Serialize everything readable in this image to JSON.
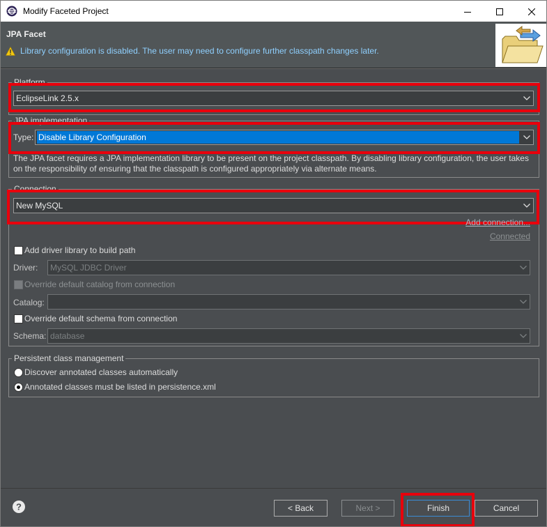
{
  "window": {
    "title": "Modify Faceted Project"
  },
  "header": {
    "title": "JPA Facet",
    "message": "Library configuration is disabled. The user may need to configure further classpath changes later."
  },
  "platform": {
    "legend": "Platform",
    "value": "EclipseLink 2.5.x"
  },
  "jpa_impl": {
    "legend": "JPA implementation",
    "type_label": "Type:",
    "type_value": "Disable Library Configuration",
    "description": "The JPA facet requires a JPA implementation library to be present on the project classpath. By disabling library configuration, the user takes on the responsibility of ensuring that the classpath is configured appropriately via alternate means."
  },
  "connection": {
    "legend": "Connection",
    "value": "New MySQL",
    "add_connection_link": "Add connection...",
    "connect_link": "Connected",
    "add_driver_label": "Add driver library to build path",
    "driver_label": "Driver:",
    "driver_value": "MySQL JDBC Driver",
    "override_catalog_label": "Override default catalog from connection",
    "catalog_label": "Catalog:",
    "catalog_value": "",
    "override_schema_label": "Override default schema from connection",
    "schema_label": "Schema:",
    "schema_value": "database"
  },
  "persistence": {
    "legend": "Persistent class management",
    "option1": "Discover annotated classes automatically",
    "option2": "Annotated classes must be listed in persistence.xml",
    "selected": "option2"
  },
  "buttons": {
    "back": "< Back",
    "next": "Next >",
    "finish": "Finish",
    "cancel": "Cancel"
  },
  "colors": {
    "highlight": "#e8000c",
    "selection": "#0078d7",
    "background": "#4a4d50"
  }
}
